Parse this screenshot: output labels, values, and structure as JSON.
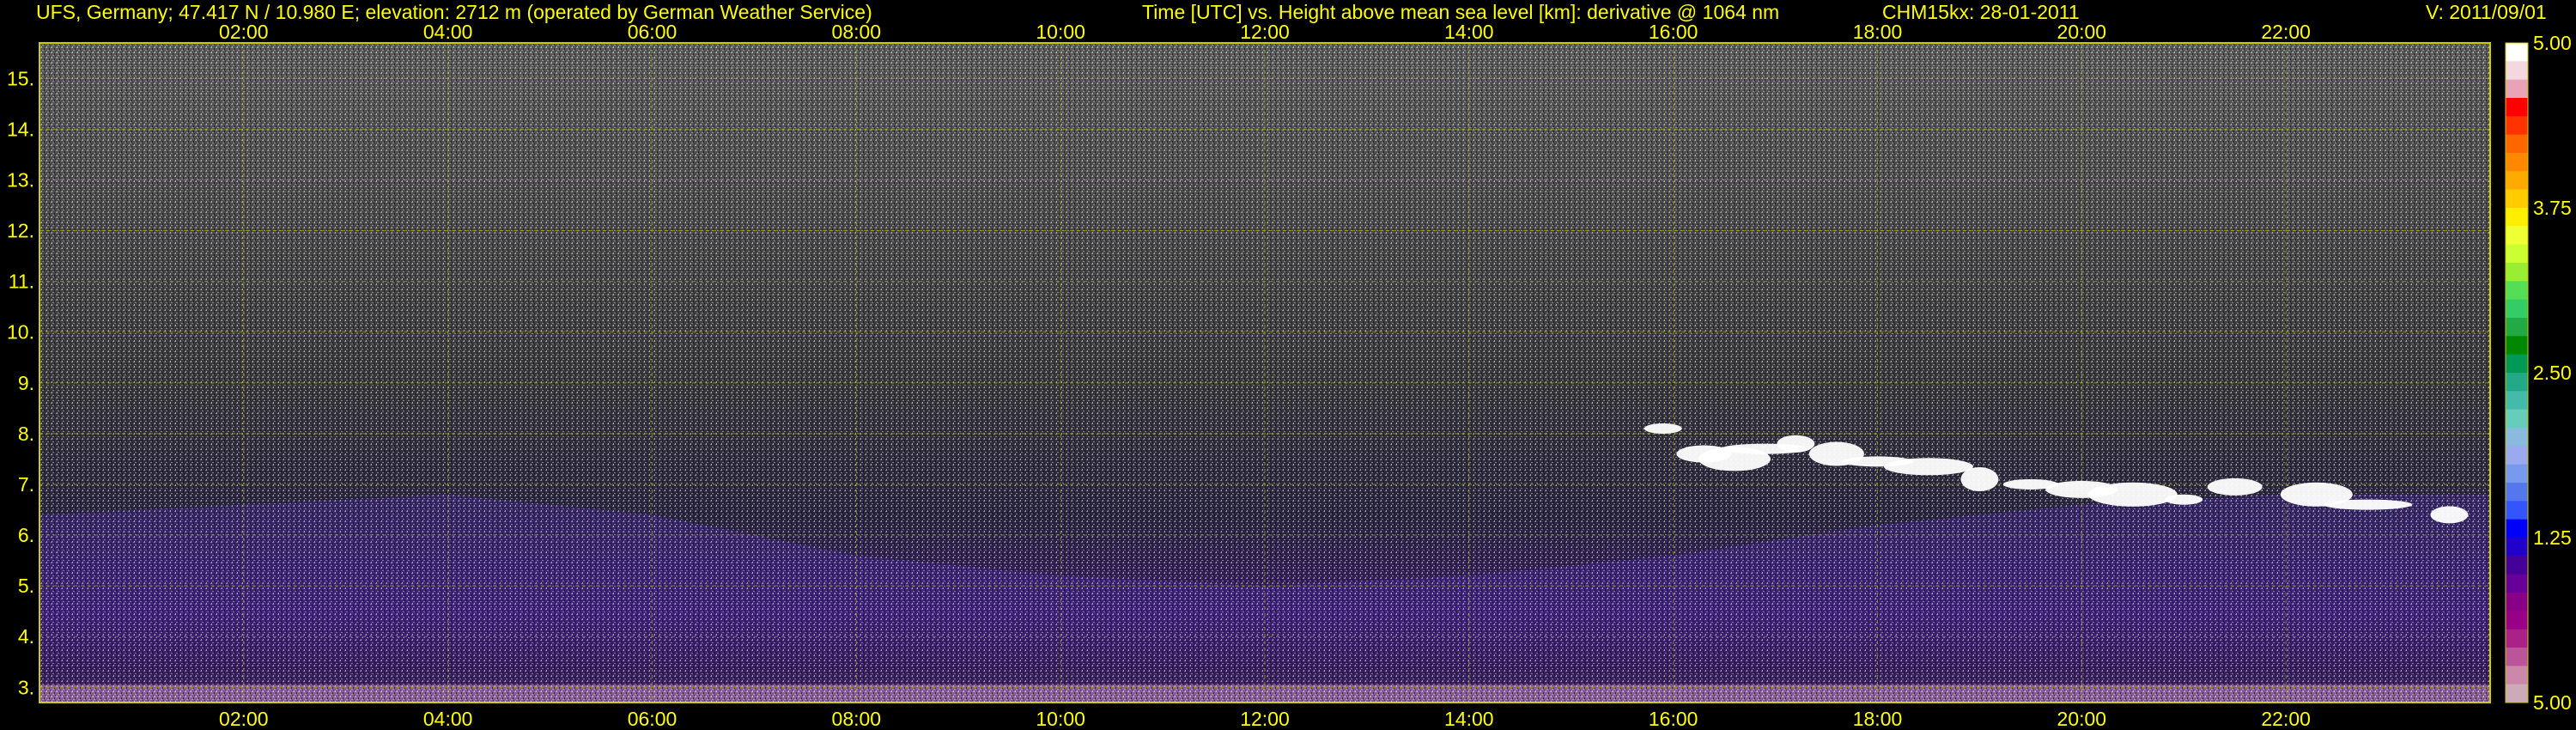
{
  "header": {
    "site": "UFS, Germany; 47.417 N / 10.980 E; elevation: 2712 m  (operated by German Weather Service)",
    "plot_desc": "Time [UTC] vs. Height above mean sea level [km]: derivative @ 1064 nm",
    "instrument": "CHM15kx: 28-01-2011",
    "version": "V: 2011/09/01"
  },
  "chart_data": {
    "type": "heatmap",
    "x": {
      "unit": "UTC hours",
      "range": [
        0,
        24
      ],
      "ticks": [
        2,
        4,
        6,
        8,
        10,
        12,
        14,
        16,
        18,
        20,
        22
      ],
      "tick_labels": [
        "02:00",
        "04:00",
        "06:00",
        "08:00",
        "10:00",
        "12:00",
        "14:00",
        "16:00",
        "18:00",
        "20:00",
        "22:00"
      ]
    },
    "y": {
      "unit": "km",
      "range": [
        2.7,
        15.7
      ],
      "ticks": [
        3,
        4,
        5,
        6,
        7,
        8,
        9,
        10,
        11,
        12,
        13,
        14,
        15
      ],
      "tick_labels": [
        "3.",
        "4.",
        "5.",
        "6.",
        "7.",
        "8.",
        "9.",
        "10.",
        "11.",
        "12.",
        "13.",
        "14.",
        "15."
      ]
    },
    "grid": true,
    "colorbar": {
      "ticks": [
        5.0,
        3.75,
        2.5,
        1.25,
        5.0
      ],
      "tick_labels": [
        "5.00",
        "3.75",
        "2.50",
        "1.25",
        "5.00"
      ],
      "colors": [
        "#ffffff",
        "#f4d7df",
        "#e8a3b6",
        "#ff0000",
        "#ff3300",
        "#ff6600",
        "#ff8800",
        "#ffaa00",
        "#ffcc00",
        "#ffee00",
        "#eeff33",
        "#ccff33",
        "#99ee33",
        "#55dd55",
        "#33cc66",
        "#22aa44",
        "#008800",
        "#009955",
        "#22aa88",
        "#44bbaa",
        "#66ccbb",
        "#88bbdd",
        "#99aaee",
        "#7799ee",
        "#5577ee",
        "#3355ff",
        "#0000ff",
        "#2200cc",
        "#440099",
        "#660099",
        "#880088",
        "#990088",
        "#aa2288",
        "#bb5599",
        "#cc88aa",
        "#ccaab8"
      ]
    },
    "aerosol_layer_top_km": [
      [
        0,
        6.4
      ],
      [
        2,
        6.6
      ],
      [
        4,
        6.8
      ],
      [
        6,
        6.4
      ],
      [
        8,
        5.6
      ],
      [
        10,
        5.2
      ],
      [
        12,
        5.0
      ],
      [
        14,
        5.2
      ],
      [
        16,
        5.6
      ],
      [
        18,
        6.2
      ],
      [
        20,
        6.6
      ],
      [
        22,
        6.8
      ],
      [
        24,
        6.8
      ]
    ],
    "cloud_layer": [
      {
        "t": 15.9,
        "h": 8.1
      },
      {
        "t": 16.3,
        "h": 7.6
      },
      {
        "t": 16.6,
        "h": 7.5
      },
      {
        "t": 16.9,
        "h": 7.7
      },
      {
        "t": 17.2,
        "h": 7.8
      },
      {
        "t": 17.6,
        "h": 7.6
      },
      {
        "t": 18.0,
        "h": 7.45
      },
      {
        "t": 18.5,
        "h": 7.35
      },
      {
        "t": 19.0,
        "h": 7.1
      },
      {
        "t": 19.5,
        "h": 7.0
      },
      {
        "t": 20.0,
        "h": 6.9
      },
      {
        "t": 20.5,
        "h": 6.8
      },
      {
        "t": 21.0,
        "h": 6.7
      },
      {
        "t": 21.5,
        "h": 6.95
      },
      {
        "t": 22.3,
        "h": 6.8
      },
      {
        "t": 22.8,
        "h": 6.6
      },
      {
        "t": 23.6,
        "h": 6.4
      }
    ]
  }
}
